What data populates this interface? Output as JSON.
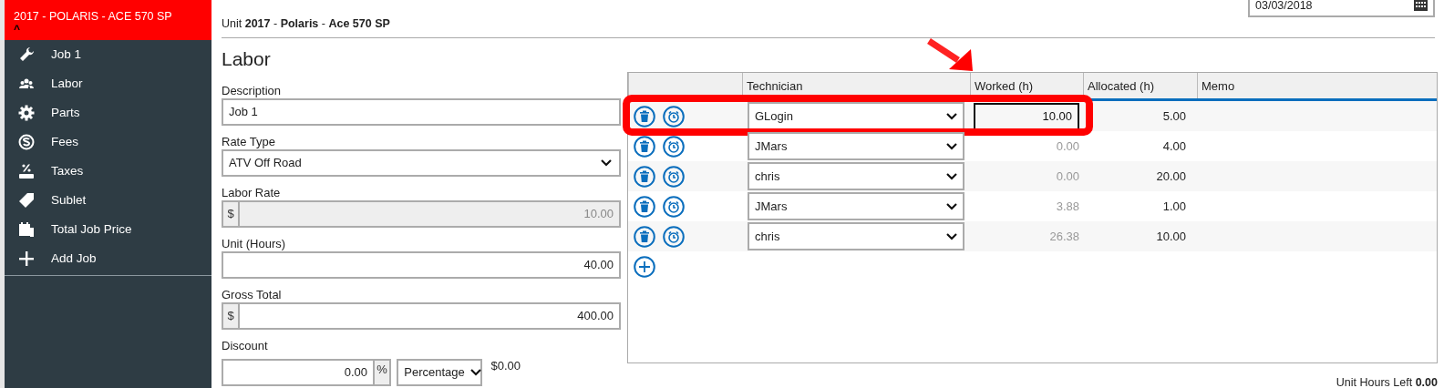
{
  "sidebar": {
    "title": "2017 - POLARIS - ACE 570 SP",
    "collapse": "^",
    "items": [
      {
        "kind": "wrench",
        "label": "Job 1"
      },
      {
        "kind": "people",
        "label": "Labor"
      },
      {
        "kind": "gear",
        "label": "Parts"
      },
      {
        "kind": "coin",
        "label": "Fees"
      },
      {
        "kind": "tax",
        "label": "Taxes"
      },
      {
        "kind": "tag",
        "label": "Sublet"
      },
      {
        "kind": "calc",
        "label": "Total Job Price"
      },
      {
        "kind": "plus",
        "label": "Add Job"
      }
    ]
  },
  "date_field": {
    "value": "03/03/2018"
  },
  "unit_line": "Unit **2017** - **Polaris** - **Ace 570 SP**",
  "section_title": "Labor",
  "form": {
    "description": {
      "label": "Description",
      "value": "Job 1"
    },
    "rate_type": {
      "label": "Rate Type",
      "value": "ATV Off Road"
    },
    "labor_rate": {
      "label": "Labor Rate",
      "prefix": "$",
      "value": "10.00",
      "disabled": true
    },
    "unit_hours": {
      "label": "Unit (Hours)",
      "value": "40.00"
    },
    "gross_total": {
      "label": "Gross Total",
      "prefix": "$",
      "value": "400.00"
    },
    "discount": {
      "label": "Discount",
      "value": "0.00",
      "suffix": "%",
      "type": "Percentage",
      "amount": "$0.00"
    }
  },
  "table": {
    "columns": [
      "Technician",
      "Worked (h)",
      "Allocated (h)",
      "Memo"
    ],
    "rows": [
      {
        "technician": "GLogin",
        "worked": "10.00",
        "allocated": "5.00",
        "editing": true,
        "highlighted": true
      },
      {
        "technician": "JMars",
        "worked": "0.00",
        "allocated": "4.00",
        "editing": false,
        "highlighted": false
      },
      {
        "technician": "chris",
        "worked": "0.00",
        "allocated": "20.00",
        "editing": false,
        "highlighted": false
      },
      {
        "technician": "JMars",
        "worked": "3.88",
        "allocated": "1.00",
        "editing": false,
        "highlighted": false
      },
      {
        "technician": "chris",
        "worked": "26.38",
        "allocated": "10.00",
        "editing": false,
        "highlighted": false
      }
    ]
  },
  "unit_hours_left": {
    "label": "Unit Hours Left",
    "value": "0.00"
  }
}
